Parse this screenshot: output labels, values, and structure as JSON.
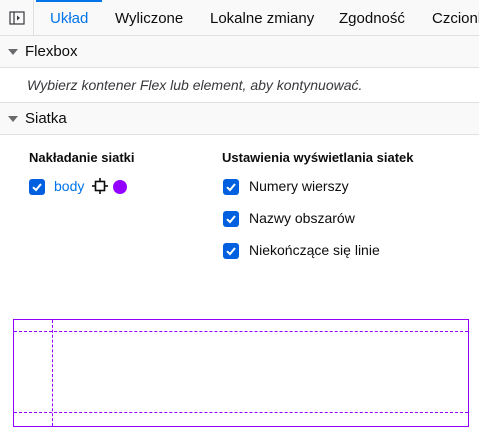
{
  "tabs": [
    {
      "label": "Układ",
      "active": true
    },
    {
      "label": "Wyliczone"
    },
    {
      "label": "Lokalne zmiany"
    },
    {
      "label": "Zgodność"
    },
    {
      "label": "Czcionk"
    }
  ],
  "flexbox": {
    "title": "Flexbox",
    "hint": "Wybierz kontener Flex lub element, aby kontynuować."
  },
  "grid": {
    "title": "Siatka",
    "overlay_title": "Nakładanie siatki",
    "overlay_item": {
      "label": "body",
      "checked": true,
      "color": "#9400ff"
    },
    "display_title": "Ustawienia wyświetlania siatek",
    "display_options": [
      {
        "label": "Numery wierszy",
        "checked": true
      },
      {
        "label": "Nazwy obszarów",
        "checked": true
      },
      {
        "label": "Niekończące się linie",
        "checked": true
      }
    ]
  },
  "colors": {
    "accent": "#0074e8",
    "checkbox": "#0060df",
    "grid_overlay": "#9400ff"
  },
  "icons": {
    "sidebar_toggle": "sidebar-toggle-icon",
    "highlight": "crosshair-icon",
    "section_expand": "chevron-down-icon"
  }
}
